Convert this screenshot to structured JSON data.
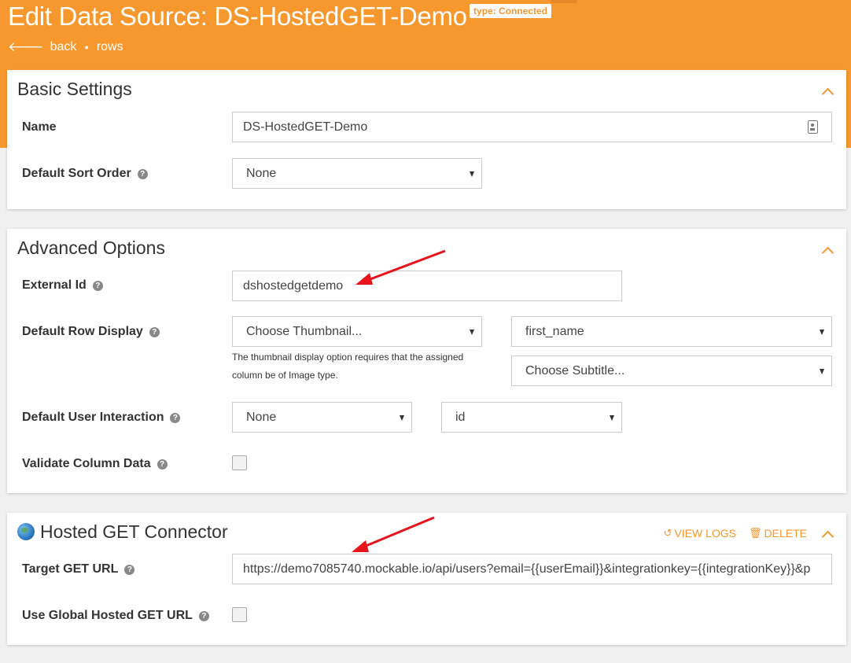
{
  "header": {
    "title": "Edit Data Source: DS-HostedGET-Demo",
    "type_badge": "type: Connected",
    "nav": {
      "back_label": "back",
      "rows_label": "rows"
    }
  },
  "basic": {
    "title": "Basic Settings",
    "name_label": "Name",
    "name_value": "DS-HostedGET-Demo",
    "sort_label": "Default Sort Order",
    "sort_value": "None"
  },
  "advanced": {
    "title": "Advanced Options",
    "external_id_label": "External Id",
    "external_id_value": "dshostedgetdemo",
    "row_display_label": "Default Row Display",
    "thumbnail_value": "Choose Thumbnail...",
    "title_column_value": "first_name",
    "subtitle_value": "Choose Subtitle...",
    "thumbnail_hint": "The thumbnail display option requires that the assigned column be of Image type.",
    "interaction_label": "Default User Interaction",
    "interaction_value": "None",
    "interaction_column_value": "id",
    "validate_label": "Validate Column Data"
  },
  "connector": {
    "title": "Hosted GET Connector",
    "view_logs_label": "VIEW LOGS",
    "delete_label": "DELETE",
    "url_label": "Target GET URL",
    "url_value": "https://demo7085740.mockable.io/api/users?email={{userEmail}}&integrationkey={{integrationKey}}&p",
    "global_label": "Use Global Hosted GET URL"
  },
  "icons": {
    "back": "arrow-left-icon",
    "help": "question-circle-icon",
    "collapse": "chevron-up-icon",
    "contact": "contact-card-icon",
    "globe": "globe-icon",
    "history": "history-icon",
    "trash": "trash-icon"
  },
  "colors": {
    "accent": "#f7982e",
    "annotation_arrow": "#e8141b"
  }
}
